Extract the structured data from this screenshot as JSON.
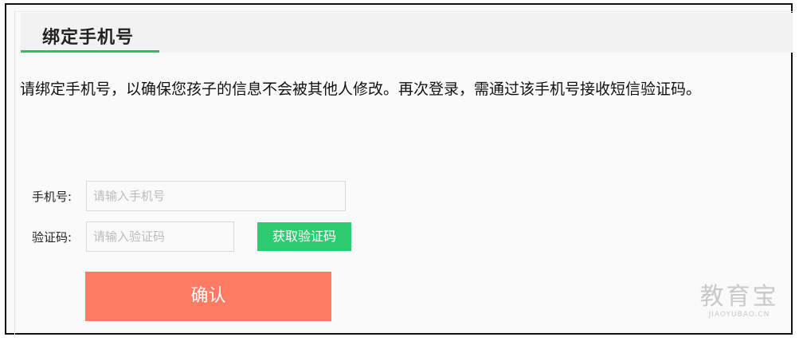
{
  "header": {
    "title": "绑定手机号"
  },
  "description": "请绑定手机号，以确保您孩子的信息不会被其他人修改。再次登录，需通过该手机号接收短信验证码。",
  "form": {
    "phone_label": "手机号:",
    "phone_placeholder": "请输入手机号",
    "code_label": "验证码:",
    "code_placeholder": "请输入验证码",
    "get_code_label": "获取验证码",
    "confirm_label": "确认"
  },
  "watermark": {
    "cn": "教育宝",
    "en": "JIAOYUBAO.CN"
  },
  "colors": {
    "accent_green": "#2ecc71",
    "confirm_orange": "#ff7b63"
  }
}
